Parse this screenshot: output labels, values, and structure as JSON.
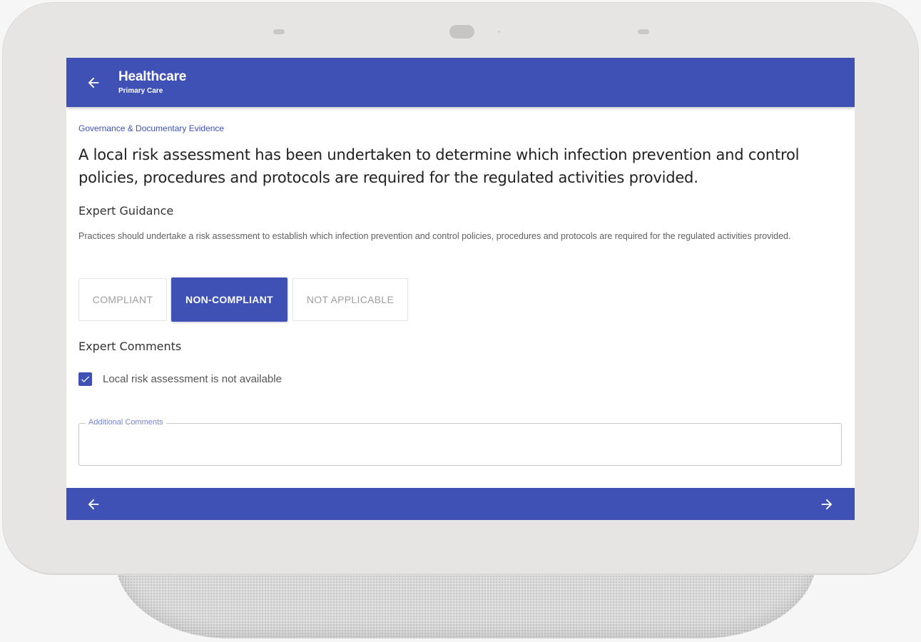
{
  "app": {
    "title": "Healthcare",
    "subtitle": "Primary Care"
  },
  "icons": {
    "back": "arrow-left-icon",
    "previous": "arrow-left-icon",
    "next": "arrow-right-icon",
    "checkbox": "check-icon"
  },
  "colors": {
    "primary": "#3f51b5",
    "accent_label": "#7986cb",
    "device_bezel": "#e6e5e4"
  },
  "breadcrumb": "Governance & Documentary Evidence",
  "question": "A local risk assessment has been undertaken to determine which infection prevention and control policies, procedures and protocols are required for the regulated activities provided.",
  "guidance": {
    "heading": "Expert Guidance",
    "text": "Practices should undertake a risk assessment to establish which infection prevention and control policies, procedures and protocols are required for the regulated activities provided."
  },
  "options": [
    {
      "label": "COMPLIANT",
      "selected": false
    },
    {
      "label": "NON-COMPLIANT",
      "selected": true
    },
    {
      "label": "NOT APPLICABLE",
      "selected": false
    }
  ],
  "comments": {
    "heading": "Expert Comments",
    "checkbox_label": "Local risk assessment is not available",
    "checkbox_checked": true,
    "field_label": "Additional Comments",
    "field_value": ""
  }
}
